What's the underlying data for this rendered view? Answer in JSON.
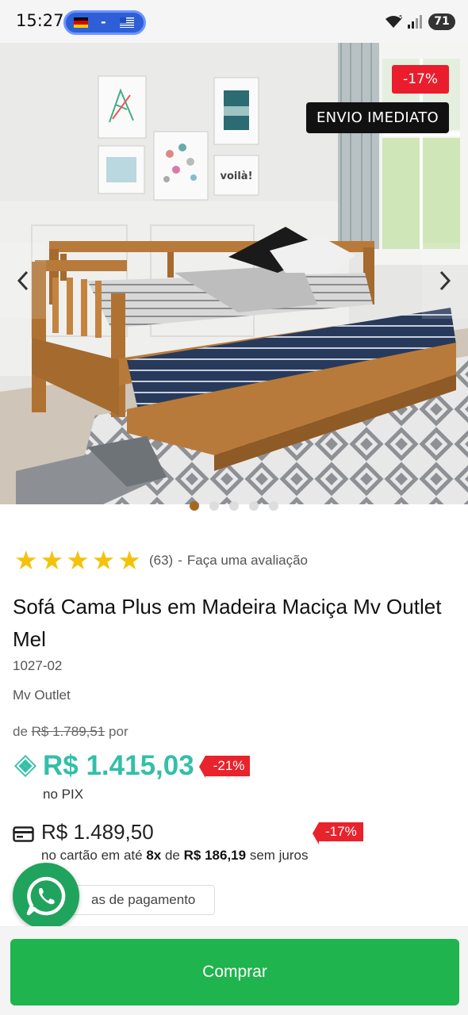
{
  "status_bar": {
    "time": "15:27",
    "translator_separator": "-",
    "battery": "71",
    "icons": [
      "flag-germany-icon",
      "flag-greece-icon",
      "wifi-icon",
      "signal-icon",
      "battery-icon"
    ]
  },
  "gallery": {
    "discount_badge": "-17%",
    "shipping_badge": "ENVIO IMEDIATO",
    "dots_total": 5,
    "active_dot": 1,
    "poster_text": "voilà!",
    "colors": {
      "active_dot": "#a66a1c",
      "badge_red": "#ea1d2c",
      "wood": "#b87a3a"
    }
  },
  "rating": {
    "stars": 5,
    "count": "(63)",
    "separator": "-",
    "review_link": "Faça uma avaliação"
  },
  "product": {
    "title": "Sofá Cama Plus em Madeira Maciça Mv Outlet Mel",
    "sku": "1027-02",
    "brand": "Mv Outlet"
  },
  "pricing": {
    "old_prefix": "de",
    "old_price": "R$ 1.789,51",
    "old_suffix": "por",
    "pix_price": "R$ 1.415,03",
    "pix_discount": "-21%",
    "pix_label": "no PIX",
    "card_price": "R$ 1.489,50",
    "card_discount": "-17%",
    "installments_prefix": "no cartão em até",
    "installments_count": "8x",
    "installments_middle": "de",
    "installments_value": "R$ 186,19",
    "installments_suffix": "sem juros",
    "payment_options_visible": "as de pagamento",
    "colors": {
      "pix": "#33bfa8",
      "discount_tag": "#e8232c"
    }
  },
  "actions": {
    "buy": "Comprar",
    "colors": {
      "buy_button": "#1fb44d",
      "whatsapp": "#20a35c"
    }
  }
}
